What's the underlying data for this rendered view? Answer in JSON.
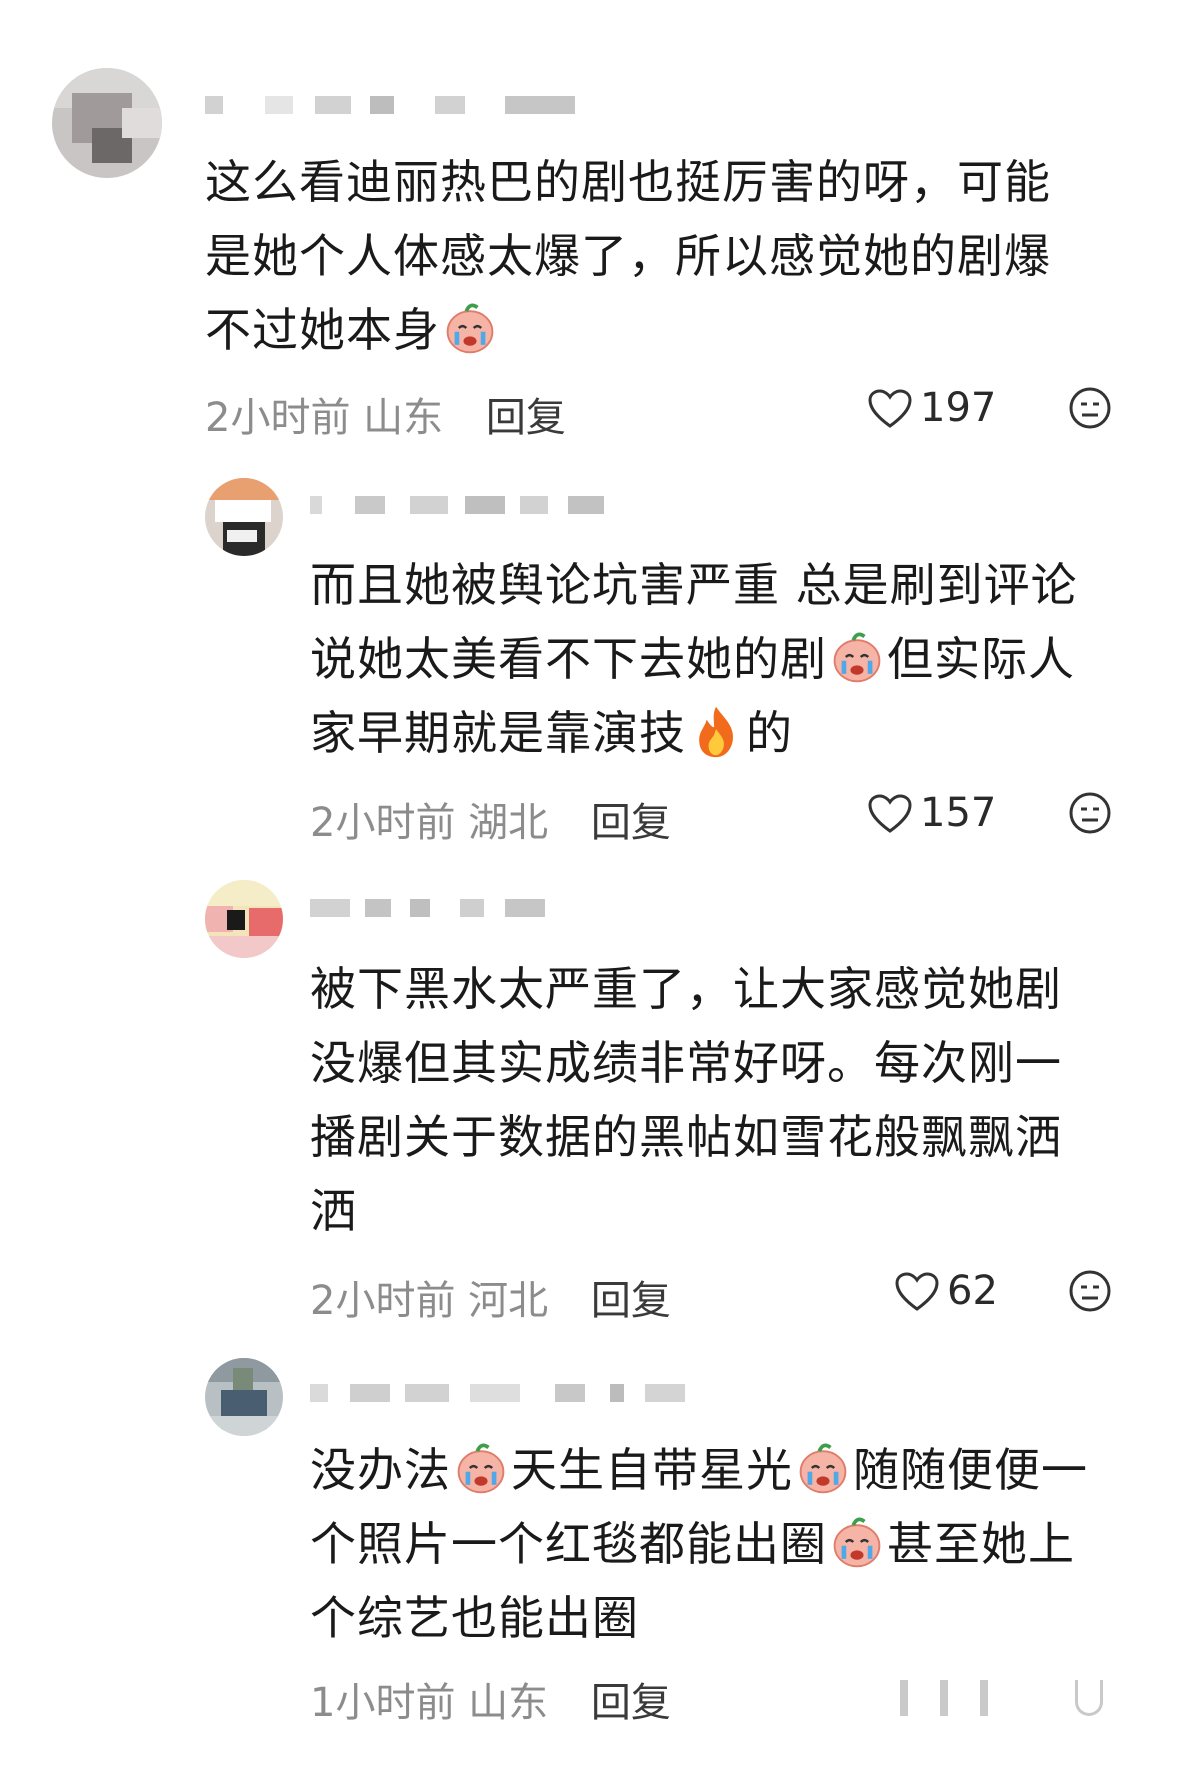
{
  "comments": [
    {
      "lines": [
        "这么看迪丽热巴的剧也挺厉害的呀，可能",
        "是她个人体感太爆了，所以感觉她的剧爆",
        "不过她本身"
      ],
      "time": "2小时前",
      "location": "山东",
      "reply_label": "回复",
      "likes": "197"
    },
    {
      "lines": [
        "而且她被舆论坑害严重 总是刷到评论",
        "说她太美看不下去她的剧",
        "但实际人",
        "家早期就是靠演技",
        "的"
      ],
      "time": "2小时前",
      "location": "湖北",
      "reply_label": "回复",
      "likes": "157"
    },
    {
      "lines": [
        "被下黑水太严重了，让大家感觉她剧",
        "没爆但其实成绩非常好呀。每次刚一",
        "播剧关于数据的黑帖如雪花般飘飘洒",
        "洒"
      ],
      "time": "2小时前",
      "location": "河北",
      "reply_label": "回复",
      "likes": "62"
    },
    {
      "lines": [
        "没办法",
        "天生自带星光",
        "随随便便一",
        "个照片一个红毯都能出圈",
        "甚至她上",
        "个综艺也能出圈"
      ],
      "time": "1小时前",
      "location": "山东",
      "reply_label": "回复"
    }
  ],
  "icons": {
    "like": "heart-outline-icon",
    "more": "meh-face-icon",
    "emoji_cry": "loudly-crying-emoji",
    "emoji_fire": "fire-emoji"
  }
}
